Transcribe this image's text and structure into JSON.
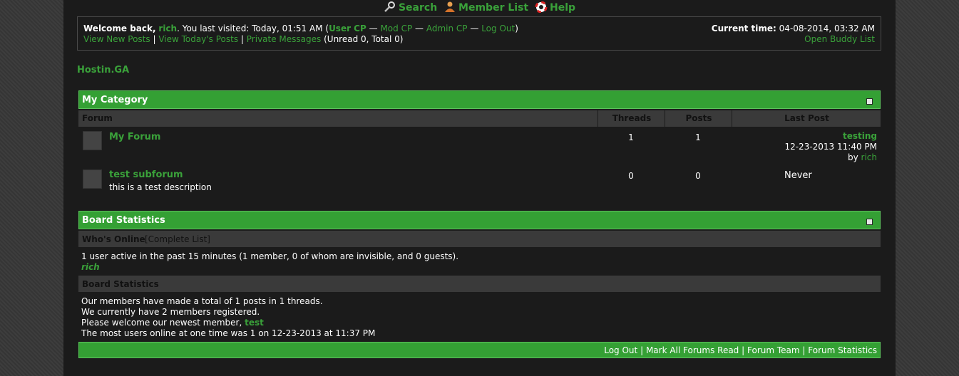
{
  "top_menu": {
    "search": "Search",
    "member_list": "Member List",
    "help": "Help"
  },
  "welcome": {
    "prefix": "Welcome back,",
    "username": "rich",
    "last_visit": ". You last visited: Today, 01:51 AM (",
    "user_cp": "User CP",
    "mod_cp": "Mod CP",
    "admin_cp": "Admin CP",
    "logout": "Log Out",
    "sep": "—",
    "close_paren": ")",
    "view_new_posts": "View New Posts",
    "view_todays_posts": "View Today's Posts",
    "private_messages": "Private Messages",
    "pm_counts": "(Unread 0, Total 0)",
    "pipe": "|",
    "current_time_label": "Current time:",
    "current_time_value": "04-08-2014, 03:32 AM",
    "open_buddy_list": "Open Buddy List"
  },
  "site_name": "Hostin.GA",
  "category": {
    "title": "My Category",
    "columns": [
      "Forum",
      "Threads",
      "Posts",
      "Last Post"
    ],
    "forums": [
      {
        "name": "My Forum",
        "description": "",
        "threads": "1",
        "posts": "1",
        "last_post_title": "testing",
        "last_post_date": "12-23-2013 11:40 PM",
        "last_post_by": "by",
        "last_post_user": "rich"
      },
      {
        "name": "test subforum",
        "description": "this is a test description",
        "threads": "0",
        "posts": "0",
        "last_post_never": "Never"
      }
    ]
  },
  "board_stats": {
    "title": "Board Statistics",
    "whos_online": "Who's Online",
    "complete_list": "[Complete List]",
    "active_users": "1 user active in the past 15 minutes (1 member, 0 of whom are invisible, and 0 guests).",
    "online_user": "rich",
    "stats_heading": "Board Statistics",
    "total_posts": "Our members have made a total of 1 posts in 1 threads.",
    "members_registered": "We currently have 2 members registered.",
    "newest_prefix": "Please welcome our newest member,",
    "newest_member": "test",
    "most_online": "The most users online at one time was 1 on 12-23-2013 at 11:37 PM"
  },
  "footer": {
    "log_out": "Log Out",
    "mark_read": "Mark All Forums Read",
    "forum_team": "Forum Team",
    "forum_statistics": "Forum Statistics",
    "pipe": "|"
  },
  "colors": {
    "accent": "#3aa13a",
    "header_bg": "#34a034",
    "page_bg": "#1b1b1b"
  }
}
